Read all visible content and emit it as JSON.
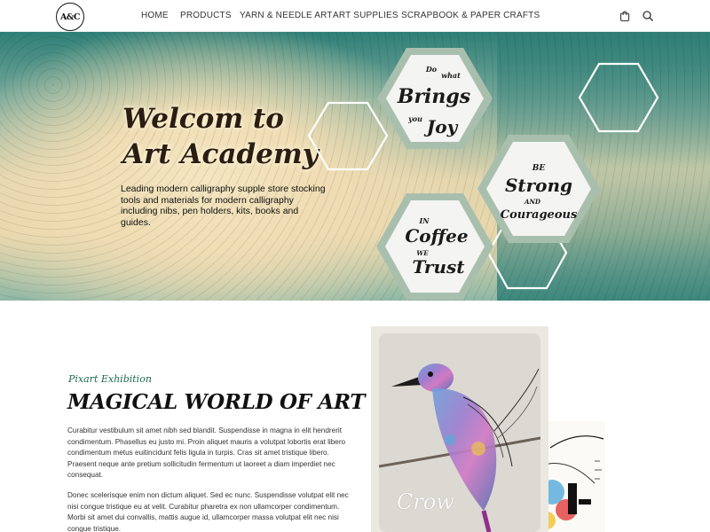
{
  "header": {
    "logo_text": "A&C",
    "nav": [
      "HOME",
      "PRODUCTS",
      "YARN & NEEDLE ART",
      "ART SUPPLIES",
      "SCRAPBOOK & PAPER CRAFTS"
    ],
    "icons": [
      "cart-icon",
      "search-icon"
    ]
  },
  "hero": {
    "title_line1": "Welcom to",
    "title_line2": "Art Academy",
    "description": "Leading modern calligraphy supple store stocking tools and materials for modern calligraphy including nibs, pen holders, kits, books and guides.",
    "hex_quotes": [
      {
        "lines": [
          "Do",
          "what",
          "Brings",
          "you",
          "Joy"
        ]
      },
      {
        "lines": [
          "BE",
          "Strong",
          "AND",
          "Courageous"
        ]
      },
      {
        "lines": [
          "IN",
          "Coffee",
          "WE",
          "Trust"
        ]
      }
    ]
  },
  "section": {
    "subtitle": "Pixart Exhibition",
    "title": "MAGICAL WORLD OF ART",
    "paragraph1": "Curabitur vestibulum sit amet nibh sed blandit. Suspendisse in magna in elit hendrerit condimentum. Phasellus eu justo mi. Proin aliquet mauris a volutpat lobortis erat libero condimentum metus euitincidunt felis ligula in turpis. Cras sit amet tristique libero. Praesent neque ante pretium sollicitudin fermentum ut laoreet a diam imperdiet nec consequat.",
    "paragraph2": "Donec scelerisque enim non dictum aliquet. Sed ec nunc. Suspendisse volutpat elit nec nisi congue tristique eu at velit. Curabitur pharetra ex non ullamcorper condimentum. Morbi sit amet dui convallis, mattis augue id, ullamcorper massa volutpat elit nec nisi congue tristique.",
    "artwork_signature": "Crow",
    "colors": {
      "accent_green": "#1d6b4f",
      "hero_teal": "#2f7f77",
      "hero_cream": "#f0ddb4"
    }
  }
}
